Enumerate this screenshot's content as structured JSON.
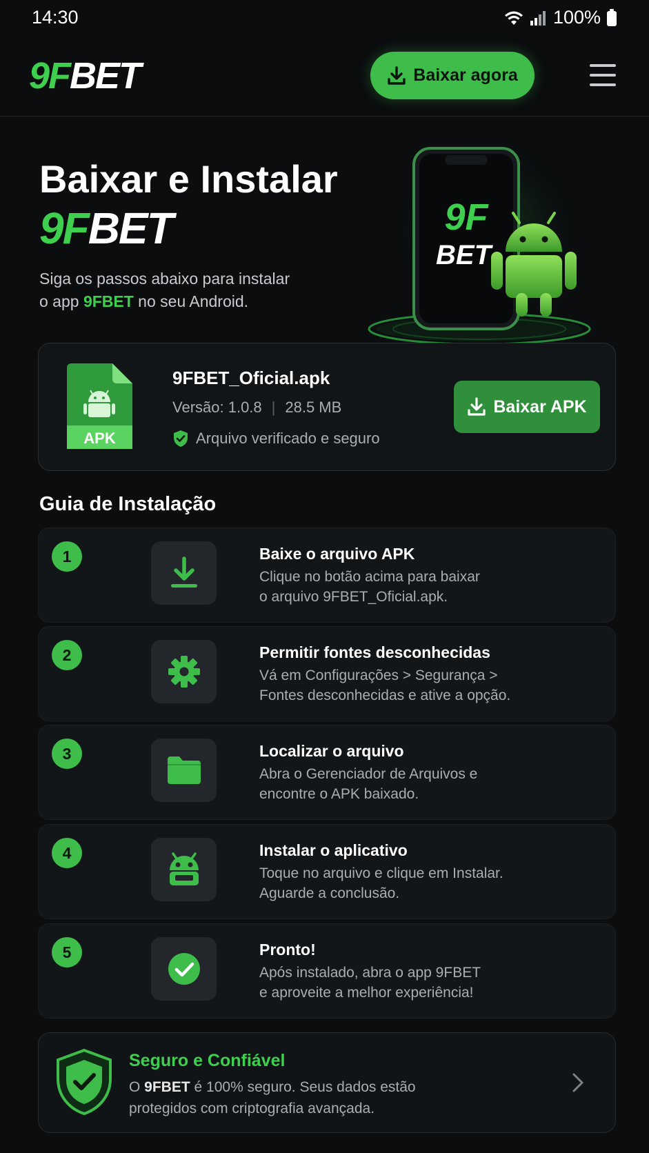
{
  "status_bar": {
    "time": "14:30",
    "battery": "100%"
  },
  "header": {
    "logo_left": "9F",
    "logo_right": "BET",
    "download_now": "Baixar agora"
  },
  "hero": {
    "title": "Baixar e Instalar",
    "brand_left": "9F",
    "brand_right": "BET",
    "subtitle_pre": "Siga os passos abaixo para instalar",
    "subtitle_line2_pre": "o app ",
    "subtitle_brand": "9FBET",
    "subtitle_post": " no seu Android.",
    "phone_logo_top": "9F",
    "phone_logo_bottom": "BET"
  },
  "apk": {
    "icon_label": "APK",
    "file_name": "9FBET_Oficial.apk",
    "version": "Versão: 1.0.8",
    "separator": "|",
    "size": "28.5 MB",
    "verified": "Arquivo verificado e seguro",
    "download_label": "Baixar APK"
  },
  "guide": {
    "title": "Guia de Instalação",
    "steps": [
      {
        "num": "1",
        "icon": "download-icon",
        "title": "Baixe o arquivo APK",
        "desc1": "Clique no botão acima para baixar",
        "desc2": "o arquivo 9FBET_Oficial.apk."
      },
      {
        "num": "2",
        "icon": "gear-icon",
        "title": "Permitir fontes desconhecidas",
        "desc1": "Vá em Configurações > Segurança >",
        "desc2": "Fontes desconhecidas e ative a opção."
      },
      {
        "num": "3",
        "icon": "folder-icon",
        "title": "Localizar o arquivo",
        "desc1": "Abra o Gerenciador de Arquivos e",
        "desc2": "encontre o APK baixado."
      },
      {
        "num": "4",
        "icon": "android-icon",
        "title": "Instalar o aplicativo",
        "desc1": "Toque no arquivo e clique em Instalar.",
        "desc2": "Aguarde a conclusão."
      },
      {
        "num": "5",
        "icon": "check-circle-icon",
        "title": "Pronto!",
        "desc1": "Após instalado, abra o app 9FBET",
        "desc2": "e aproveite a melhor experiência!"
      }
    ]
  },
  "safe": {
    "title": "Seguro e Confiável",
    "desc_pre": "O ",
    "desc_brand": "9FBET",
    "desc_mid": " é 100% seguro. Seus dados estão",
    "desc_line2": "protegidos com criptografia avançada."
  },
  "colors": {
    "accent": "#3ecf4f",
    "button_green": "#3ebd4a",
    "apk_button": "#2f8f3a",
    "background": "#0b0d0f"
  }
}
